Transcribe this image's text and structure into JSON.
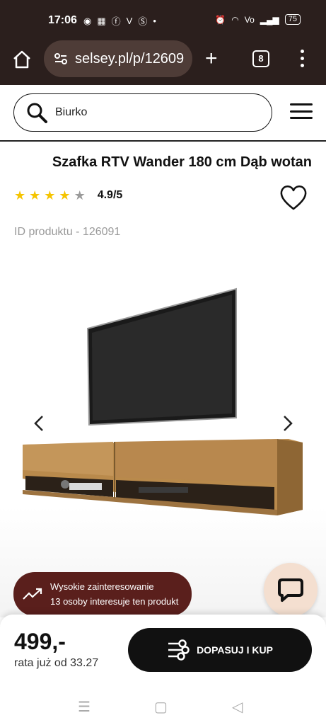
{
  "status_bar": {
    "time": "17:06",
    "battery": "75"
  },
  "browser": {
    "url": "selsey.pl/p/12609",
    "tab_count": "8"
  },
  "search": {
    "value": "Biurko"
  },
  "product": {
    "title": "Szafka RTV Wander 180 cm Dąb wotan",
    "rating": "4.9/5",
    "stars_filled": 4,
    "stars_total": 5,
    "product_id": "ID produktu - 126091"
  },
  "interest": {
    "line1": "Wysokie zainteresowanie",
    "line2": "13 osoby interesuje ten produkt"
  },
  "purchase": {
    "price": "499,-",
    "installment": "rata już od 33.27",
    "button_label": "DOPASUJ I KUP"
  },
  "colors": {
    "chrome_bg": "#2b1f1d",
    "url_bg": "#4e3c37",
    "interest_bg": "#5a1f1c",
    "chat_bg": "#f4dfd0",
    "star": "#f5c400"
  }
}
